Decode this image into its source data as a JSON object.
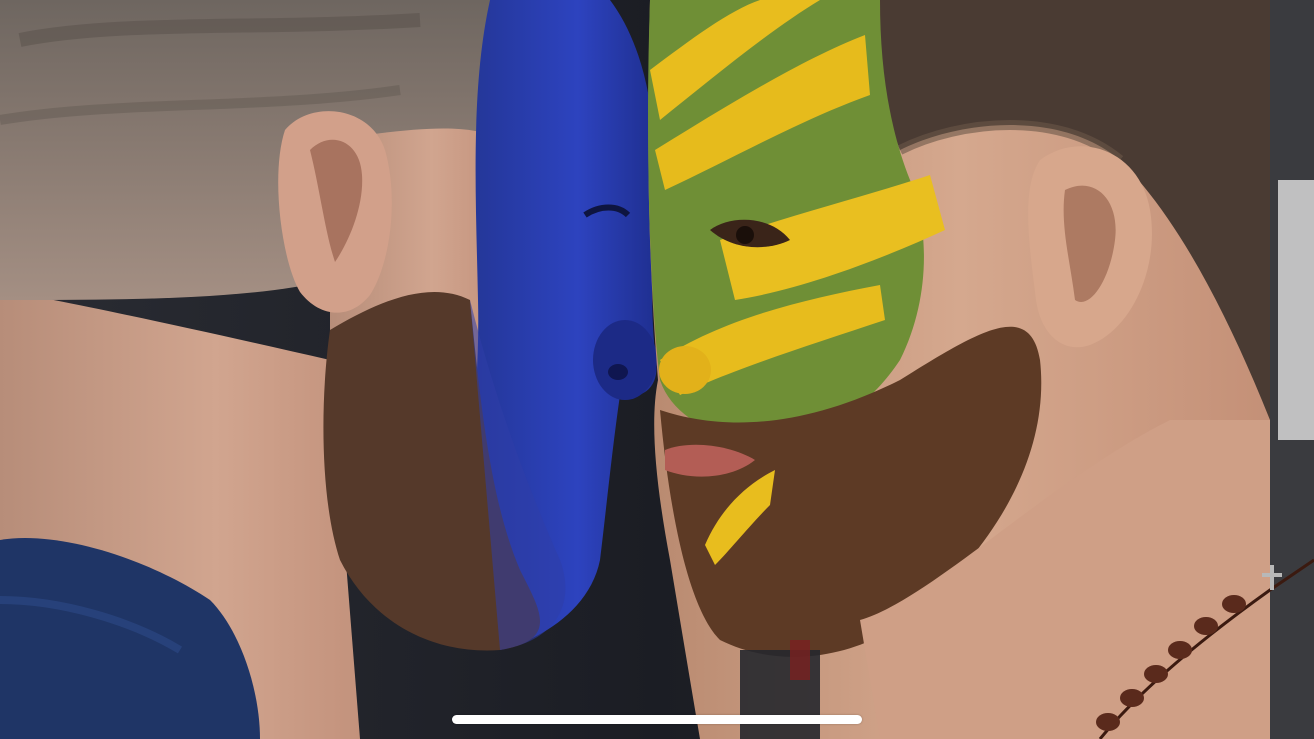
{
  "photo": {
    "subject": "face-off-close-up",
    "colors": {
      "background": "#1d1f26",
      "left_face_paint": "#2a3fb5",
      "right_face_paint_green": "#6f8f36",
      "right_face_paint_yellow": "#e8bd1e",
      "skin": "#c99a80",
      "beard": "#5a3a26",
      "shirt": "#1f3566",
      "necklace": "#5a2a1c"
    }
  },
  "system_ui": {
    "home_indicator": "home-indicator-bar"
  }
}
